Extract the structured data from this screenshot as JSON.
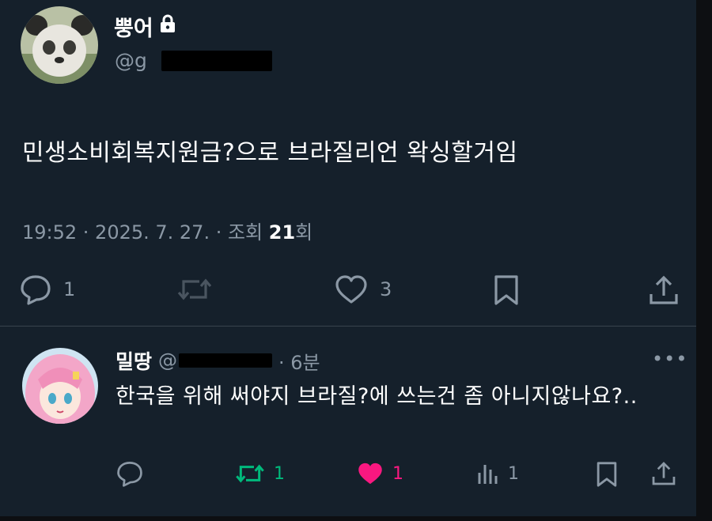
{
  "tweet": {
    "author_name": "뿡어",
    "author_handle": "@g",
    "text": "민생소비회복지원금?으로 브라질리언 왁싱할거임",
    "time": "19:52 · 2025. 7. 27. · 조회 ",
    "views_count": "21",
    "views_suffix": "회",
    "actions": {
      "reply_count": "1",
      "like_count": "3"
    }
  },
  "reply": {
    "author_name": "밀땅",
    "author_handle": "@",
    "time": "· 6분",
    "text": "한국을 위해 써야지 브라질?에 쓰는건 좀 아니지않나요?..",
    "actions": {
      "reply_count": "",
      "retweet_count": "1",
      "like_count": "1",
      "views_count": "1"
    }
  },
  "colors": {
    "background": "#15202b",
    "secondary_text": "#8b98a5",
    "retweet_active": "#00ba7c",
    "like_active": "#f91880"
  }
}
